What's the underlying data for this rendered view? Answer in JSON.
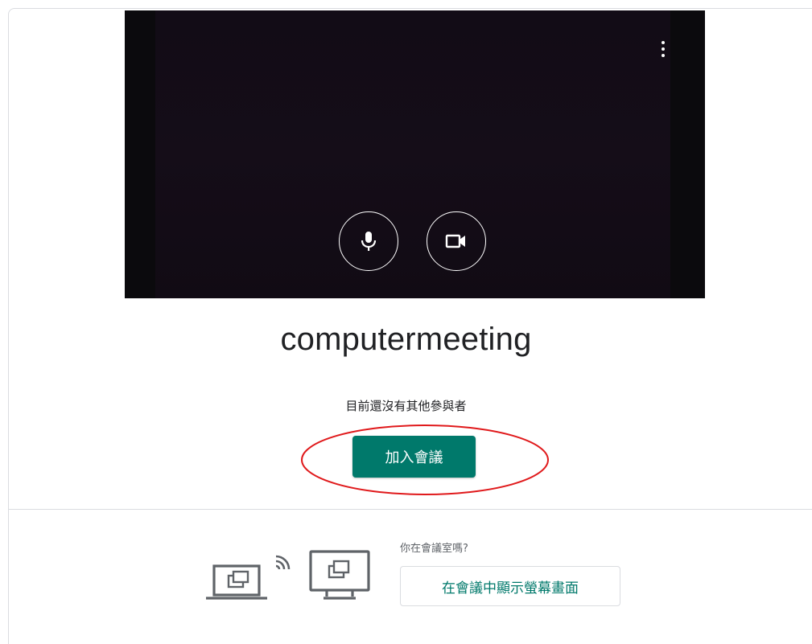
{
  "meeting": {
    "name": "computermeeting",
    "participants_status": "目前還沒有其他參與者",
    "join_label": "加入會議"
  },
  "video_preview": {
    "controls": [
      {
        "name": "mic-icon",
        "state": "on"
      },
      {
        "name": "camera-icon",
        "state": "on"
      }
    ],
    "menu_icon": "more-vert-icon"
  },
  "room": {
    "question": "你在會議室嗎?",
    "present_label": "在會議中顯示螢幕畫面"
  },
  "colors": {
    "accent": "#00796b",
    "annotation": "#e0191b",
    "video_bg": "#0b0a0d"
  }
}
